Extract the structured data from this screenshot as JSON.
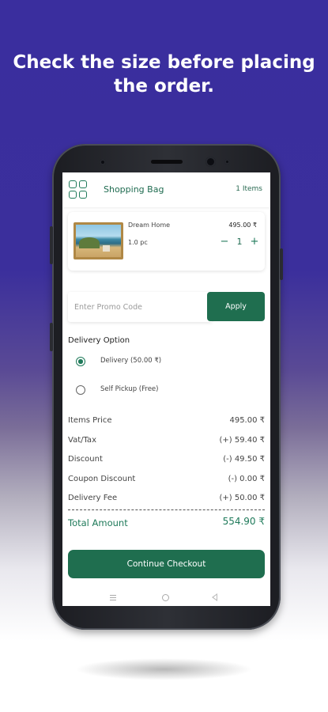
{
  "headline": {
    "line1": "Check the size before placing",
    "line2": "the order."
  },
  "app": {
    "title": "Shopping Bag",
    "item_count": "1 Items",
    "accent_color": "#1f6e4f"
  },
  "cart": {
    "items": [
      {
        "name": "Dream Home",
        "quantity_text": "1.0 pc",
        "price": "495.00 ₹",
        "quantity": "1",
        "minus_icon": "minus-icon",
        "plus_icon": "plus-icon"
      }
    ]
  },
  "promo": {
    "placeholder": "Enter Promo Code",
    "button_label": "Apply"
  },
  "delivery": {
    "section_label": "Delivery Option",
    "options": [
      {
        "label": "Delivery  (50.00 ₹)",
        "selected": true
      },
      {
        "label": "Self Pickup  (Free)",
        "selected": false
      }
    ]
  },
  "summary": {
    "rows": [
      {
        "label": "Items Price",
        "value": "495.00 ₹"
      },
      {
        "label": "Vat/Tax",
        "value": "(+) 59.40 ₹"
      },
      {
        "label": "Discount",
        "value": "(-) 49.50 ₹"
      },
      {
        "label": "Coupon Discount",
        "value": "(-) 0.00 ₹"
      },
      {
        "label": "Delivery Fee",
        "value": "(+) 50.00 ₹"
      }
    ],
    "total_label": "Total Amount",
    "total_value": "554.90 ₹"
  },
  "checkout": {
    "button_label": "Continue Checkout"
  },
  "system_nav": {
    "icons": [
      "menu-icon",
      "home-icon",
      "back-icon"
    ]
  }
}
